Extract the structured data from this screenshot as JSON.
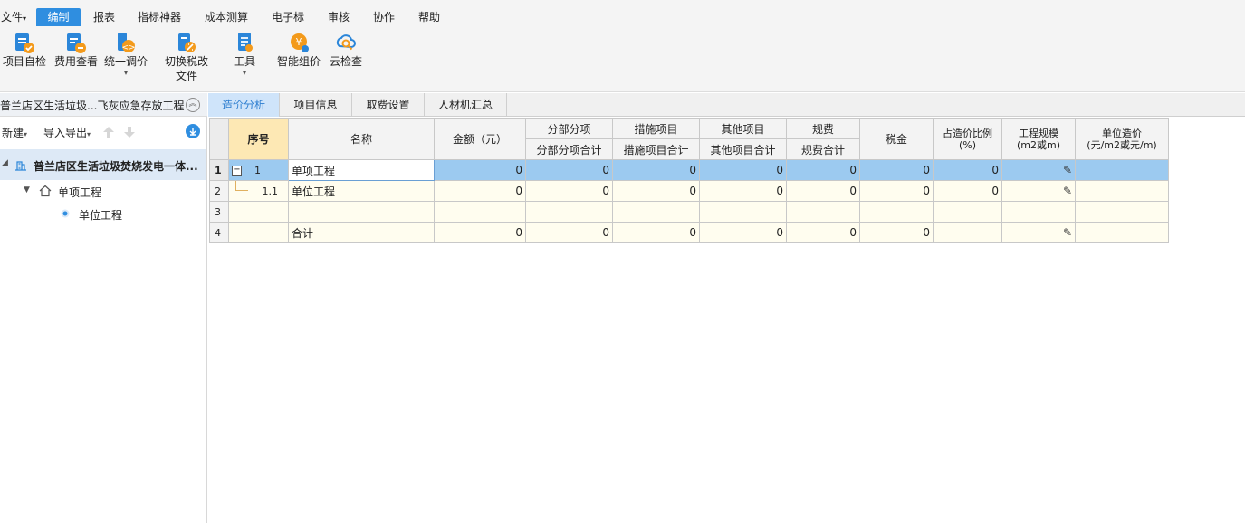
{
  "menu": {
    "items": [
      {
        "label": "文件"
      },
      {
        "label": "编制"
      },
      {
        "label": "报表"
      },
      {
        "label": "指标神器"
      },
      {
        "label": "成本测算"
      },
      {
        "label": "电子标"
      },
      {
        "label": "审核"
      },
      {
        "label": "协作"
      },
      {
        "label": "帮助"
      }
    ],
    "file_caret": "▾"
  },
  "toolbar": {
    "self_check": "项目自检",
    "fee_view": "费用查看",
    "unify_price": "统一调价",
    "switch_tax_1": "切换税改",
    "switch_tax_2": "文件",
    "tools": "工具",
    "smart_price": "智能组价",
    "cloud_check": "云检查",
    "caret": "▾"
  },
  "left_panel": {
    "title": "普兰店区生活垃圾...飞灰应急存放工程",
    "new_label": "新建",
    "import_export_label": "导入导出",
    "caret": "▾",
    "tree": {
      "root": "普兰店区生活垃圾焚烧发电一体...",
      "single": "单项工程",
      "unit": "单位工程"
    }
  },
  "tabs": [
    {
      "label": "造价分析"
    },
    {
      "label": "项目信息"
    },
    {
      "label": "取费设置"
    },
    {
      "label": "人材机汇总"
    }
  ],
  "grid": {
    "headers": {
      "seq": "序号",
      "name": "名称",
      "amount": "金额（元）",
      "fbfx": "分部分项",
      "fbfx_sum": "分部分项合计",
      "csxm": "措施项目",
      "csxm_sum": "措施项目合计",
      "qtxm": "其他项目",
      "qtxm_sum": "其他项目合计",
      "gf": "规费",
      "gf_sum": "规费合计",
      "tax": "税金",
      "ratio_1": "占造价比例",
      "ratio_2": "(%)",
      "scale_1": "工程规模",
      "scale_2": "(m2或m)",
      "unit_price_1": "单位造价",
      "unit_price_2": "(元/m2或元/m)"
    },
    "rows": [
      {
        "rn": "1",
        "seq": "1",
        "name": "单项工程",
        "amount": "0",
        "fbfx": "0",
        "csxm": "0",
        "qtxm": "0",
        "gf": "0",
        "tax": "0",
        "ratio": "0",
        "pen": "✎"
      },
      {
        "rn": "2",
        "seq": "1.1",
        "name": "单位工程",
        "amount": "0",
        "fbfx": "0",
        "csxm": "0",
        "qtxm": "0",
        "gf": "0",
        "tax": "0",
        "ratio": "0",
        "pen": "✎"
      },
      {
        "rn": "3",
        "seq": "",
        "name": "",
        "amount": "",
        "fbfx": "",
        "csxm": "",
        "qtxm": "",
        "gf": "",
        "tax": "",
        "ratio": "",
        "pen": ""
      },
      {
        "rn": "4",
        "seq": "",
        "name": "合计",
        "amount": "0",
        "fbfx": "0",
        "csxm": "0",
        "qtxm": "0",
        "gf": "0",
        "tax": "0",
        "ratio": "",
        "pen": "✎"
      }
    ]
  },
  "colors": {
    "accent": "#2f8ee0",
    "selected_row": "#9ccaf0",
    "seq_header": "#fde8b4",
    "tree_selected": "#dde9f6",
    "icon_blue": "#2b86d9",
    "icon_orange": "#f39a1b"
  }
}
